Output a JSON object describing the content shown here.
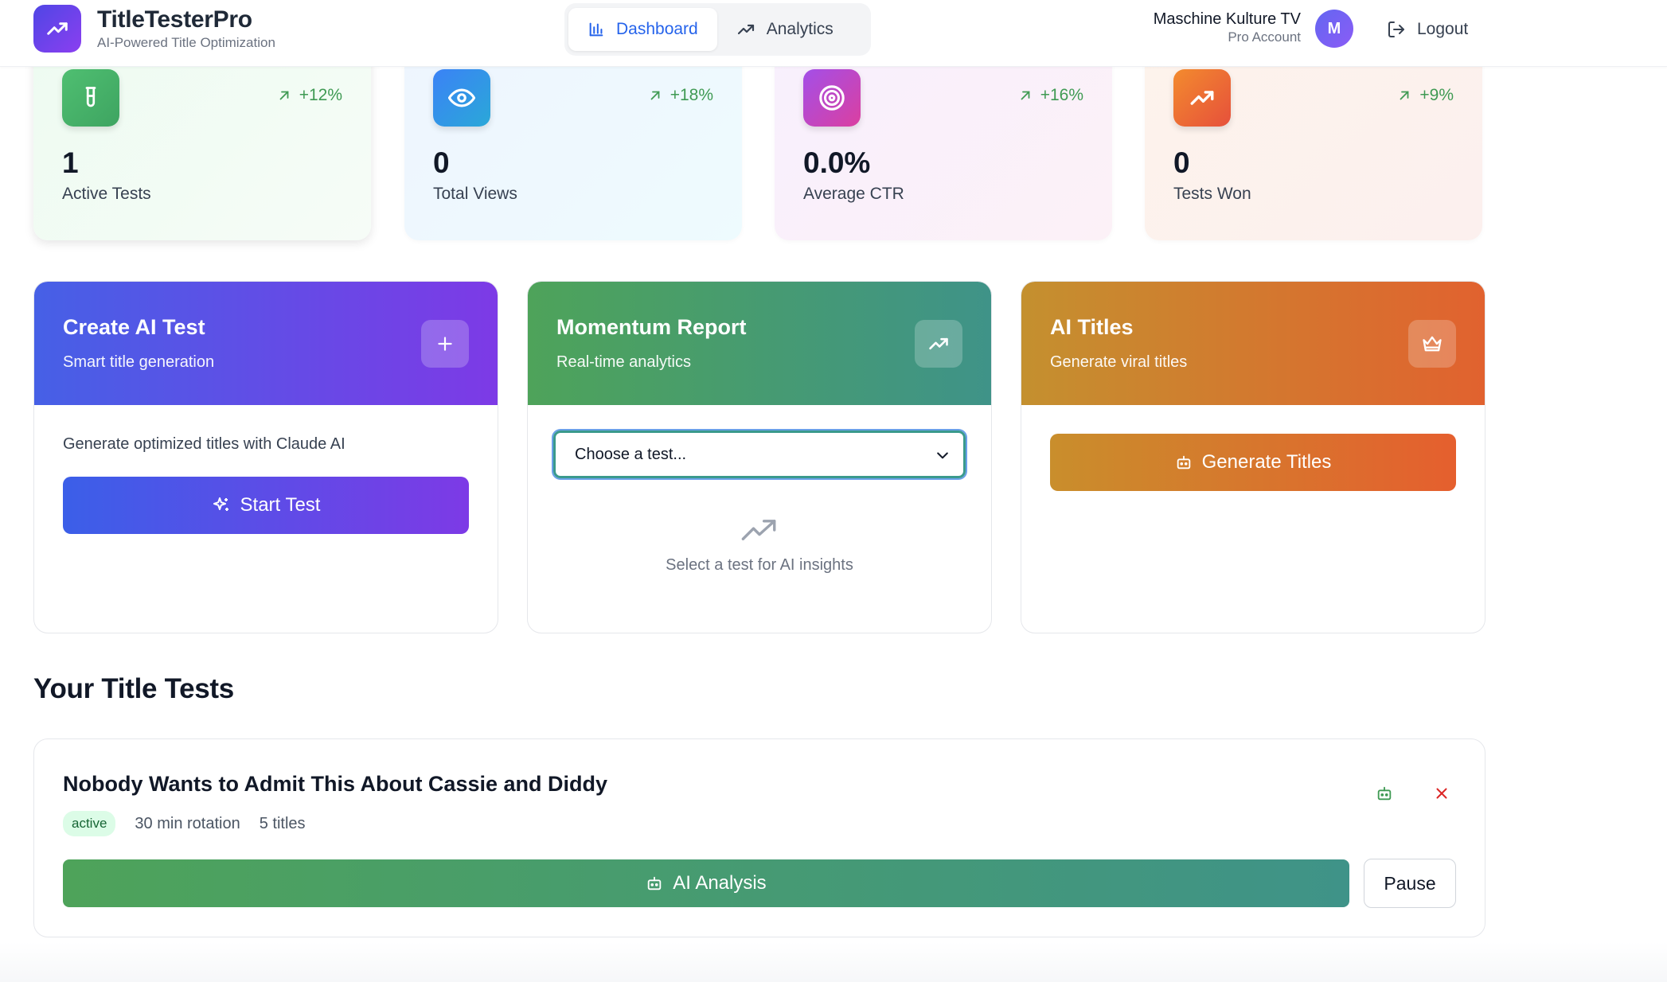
{
  "app": {
    "name": "TitleTesterPro",
    "tagline": "AI-Powered Title Optimization"
  },
  "nav": {
    "items": [
      {
        "label": "Dashboard",
        "icon": "bar-chart-icon",
        "active": true
      },
      {
        "label": "Analytics",
        "icon": "trending-up-icon",
        "active": false
      }
    ]
  },
  "user": {
    "name": "Maschine Kulture TV",
    "plan": "Pro Account",
    "initial": "M",
    "logout_label": "Logout"
  },
  "stats": [
    {
      "value": "1",
      "label": "Active Tests",
      "trend": "+12%",
      "icon": "test-tube-icon",
      "color": "#4fbf71"
    },
    {
      "value": "0",
      "label": "Total Views",
      "trend": "+18%",
      "icon": "eye-icon",
      "color": "#3b82f6"
    },
    {
      "value": "0.0%",
      "label": "Average CTR",
      "trend": "+16%",
      "icon": "target-icon",
      "color": "#a34fe8"
    },
    {
      "value": "0",
      "label": "Tests Won",
      "trend": "+9%",
      "icon": "trending-up-icon",
      "color": "#f38b2e"
    }
  ],
  "features": {
    "create": {
      "title": "Create AI Test",
      "subtitle": "Smart title generation",
      "description": "Generate optimized titles with Claude AI",
      "button": "Start Test"
    },
    "momentum": {
      "title": "Momentum Report",
      "subtitle": "Real-time analytics",
      "select_value": "Choose a test...",
      "empty_text": "Select a test for AI insights"
    },
    "ai_titles": {
      "title": "AI Titles",
      "subtitle": "Generate viral titles",
      "button": "Generate Titles"
    }
  },
  "tests_section": {
    "title": "Your Title Tests",
    "tests": [
      {
        "title": "Nobody Wants to Admit This About Cassie and Diddy",
        "status": "active",
        "rotation": "30 min rotation",
        "titles_count": "5 titles",
        "analysis_button": "AI Analysis",
        "pause_button": "Pause"
      }
    ]
  },
  "colors": {
    "primary": "#2563eb",
    "success": "#3f9a53",
    "danger": "#dc2626"
  }
}
